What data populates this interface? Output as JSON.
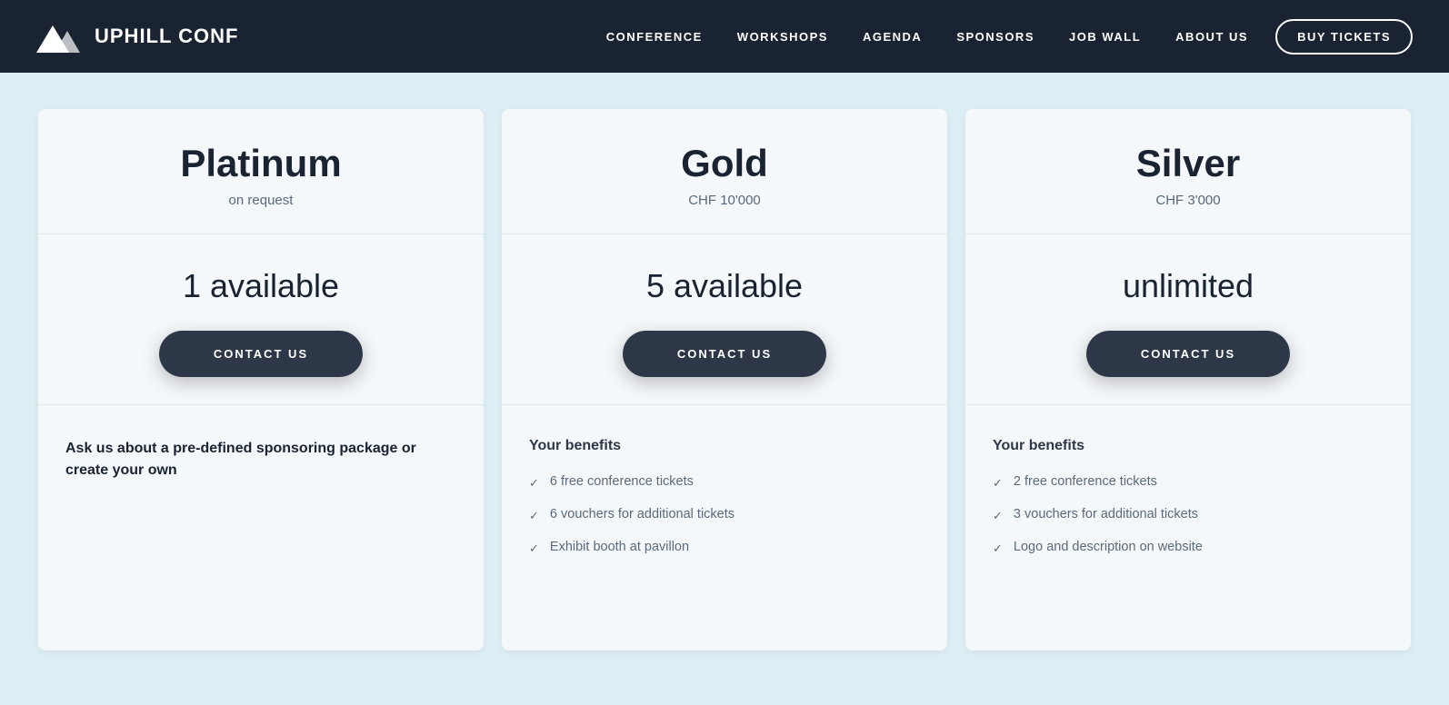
{
  "navbar": {
    "logo_text": "UPHILL CONF",
    "nav_items": [
      {
        "label": "CONFERENCE",
        "id": "conference"
      },
      {
        "label": "WORKSHOPS",
        "id": "workshops"
      },
      {
        "label": "AGENDA",
        "id": "agenda"
      },
      {
        "label": "SPONSORS",
        "id": "sponsors"
      },
      {
        "label": "JOB WALL",
        "id": "jobwall"
      },
      {
        "label": "ABOUT US",
        "id": "aboutus"
      }
    ],
    "buy_tickets_label": "BUY TICKETS"
  },
  "tiers": [
    {
      "id": "platinum",
      "name": "Platinum",
      "price": "on request",
      "availability": "1 available",
      "contact_label": "CONTACT US",
      "has_custom_text": true,
      "custom_text": "Ask us about a pre-defined sponsoring package or create your own",
      "benefits": []
    },
    {
      "id": "gold",
      "name": "Gold",
      "price": "CHF 10'000",
      "availability": "5 available",
      "contact_label": "CONTACT US",
      "has_custom_text": false,
      "custom_text": "",
      "benefits_title": "Your benefits",
      "benefits": [
        "6 free conference tickets",
        "6 vouchers for additional tickets",
        "Exhibit booth at pavillon"
      ]
    },
    {
      "id": "silver",
      "name": "Silver",
      "price": "CHF 3'000",
      "availability": "unlimited",
      "contact_label": "CONTACT US",
      "has_custom_text": false,
      "custom_text": "",
      "benefits_title": "Your benefits",
      "benefits": [
        "2 free conference tickets",
        "3 vouchers for additional tickets",
        "Logo and description on website"
      ]
    }
  ]
}
